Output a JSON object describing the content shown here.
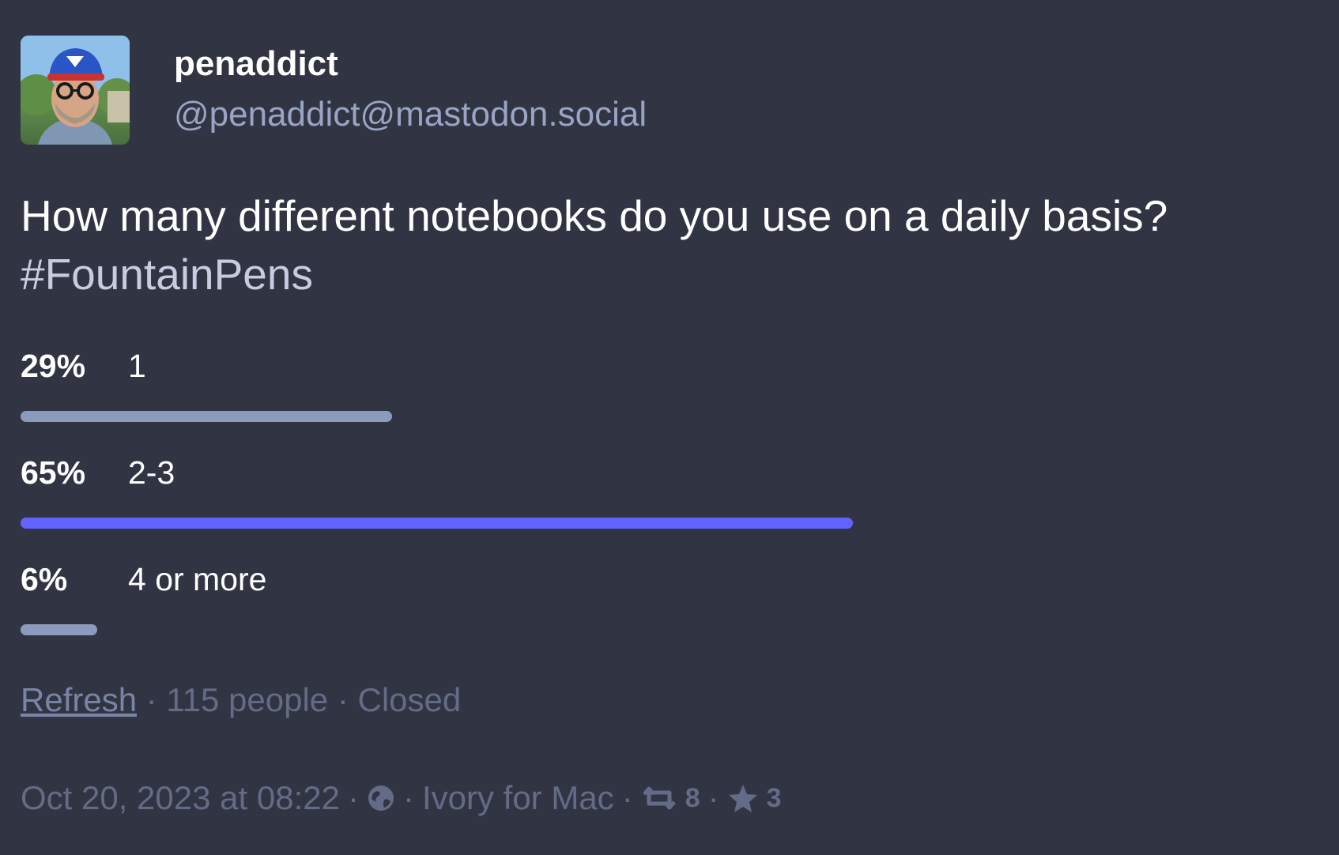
{
  "account": {
    "display_name": "penaddict",
    "handle": "@penaddict@mastodon.social"
  },
  "status": {
    "text": "How many different notebooks do you use on a daily basis?",
    "hashtag": "#FountainPens"
  },
  "poll": {
    "options": [
      {
        "percent_label": "29%",
        "label": "1",
        "percent": 29,
        "leading": false
      },
      {
        "percent_label": "65%",
        "label": "2-3",
        "percent": 65,
        "leading": true
      },
      {
        "percent_label": "6%",
        "label": "4 or more",
        "percent": 6,
        "leading": false
      }
    ],
    "refresh_label": "Refresh",
    "voters": "115 people",
    "state": "Closed",
    "separator": "·"
  },
  "meta": {
    "timestamp": "Oct 20, 2023 at 08:22",
    "visibility_icon": "globe-icon",
    "app": "Ivory for Mac",
    "boost_icon": "boost-icon",
    "boosts": "8",
    "favourite_icon": "star-icon",
    "favourites": "3"
  },
  "colors": {
    "background": "#313543",
    "leading_bar": "#6364ff",
    "bar": "#8c9bbd",
    "muted": "#636b86"
  }
}
